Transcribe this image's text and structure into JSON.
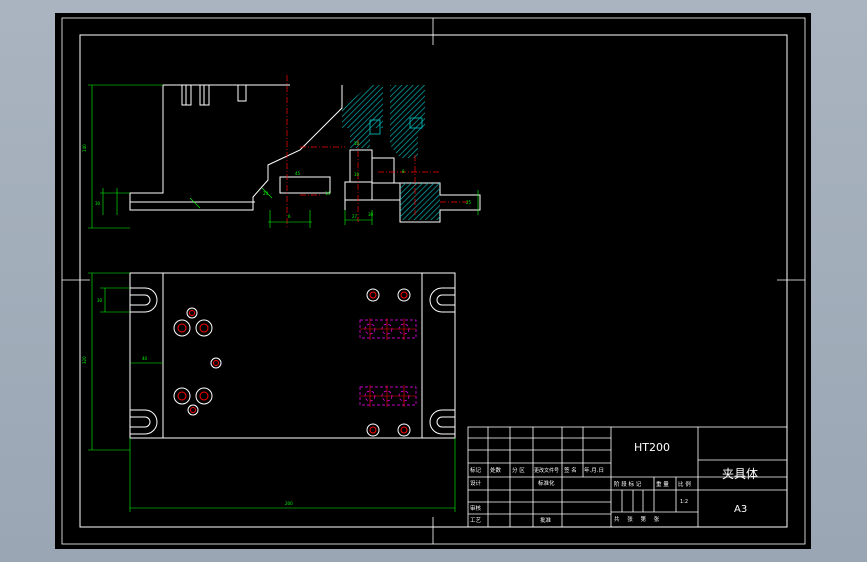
{
  "title_block": {
    "material": "HT200",
    "part_name": "夹具体",
    "sheet_size": "A3",
    "scale": "1:2",
    "row_labels": {
      "mark": "标记",
      "count": "处数",
      "zone": "分 区",
      "change_doc": "更改文件号",
      "signature": "签 名",
      "date": "年.月.日",
      "design": "设计",
      "standardize": "标准化",
      "review": "审核",
      "process": "工艺",
      "approve": "批准",
      "stage_marks": "阶 段 标 记",
      "weight": "重 量",
      "ratio": "比 例",
      "sheets": "共 张 第 张"
    }
  },
  "dimensions": {
    "top_view": [
      "140",
      "30",
      "45",
      "20",
      "14",
      "6",
      "27",
      "30",
      "10",
      "10",
      "8",
      "25"
    ],
    "bottom_view": [
      "320",
      "200",
      "30",
      "40"
    ]
  },
  "colors": {
    "background": "#000000",
    "frame": "#ffffff",
    "dimension": "#00ff00",
    "centerline": "#ff0000",
    "hatch": "#00c8c8",
    "bolt_circle": "#ff0000",
    "hidden": "#ff00ff"
  }
}
